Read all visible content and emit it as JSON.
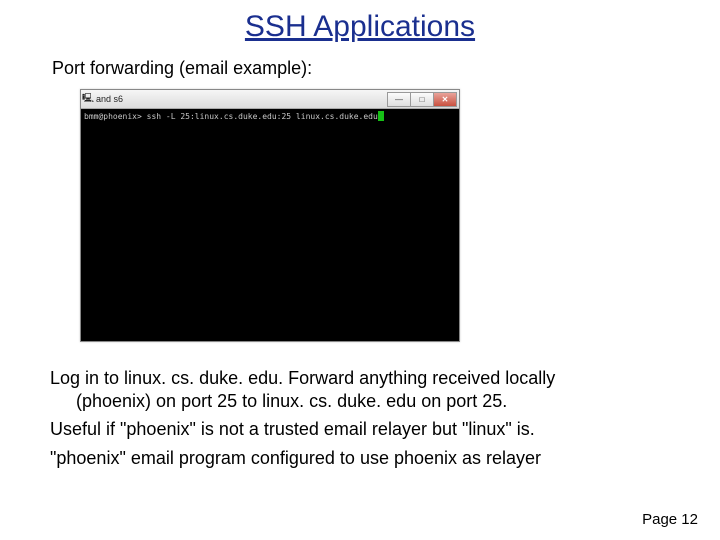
{
  "title": "SSH Applications",
  "subtitle": "Port forwarding (email example):",
  "window": {
    "title": "and s6",
    "icon_glyph": "🖳"
  },
  "terminal": {
    "prompt": "bmm@phoenix> ",
    "command": "ssh -L 25:linux.cs.duke.edu:25 linux.cs.duke.edu"
  },
  "body": {
    "p1a": "Log in to linux. cs. duke. edu.  Forward anything received locally",
    "p1b": "(phoenix) on port 25 to linux. cs. duke. edu on port 25.",
    "p2": "Useful if \"phoenix\" is not a trusted email relayer but \"linux\" is.",
    "p3": "\"phoenix\" email program configured to use phoenix as relayer"
  },
  "page_number": "Page 12"
}
